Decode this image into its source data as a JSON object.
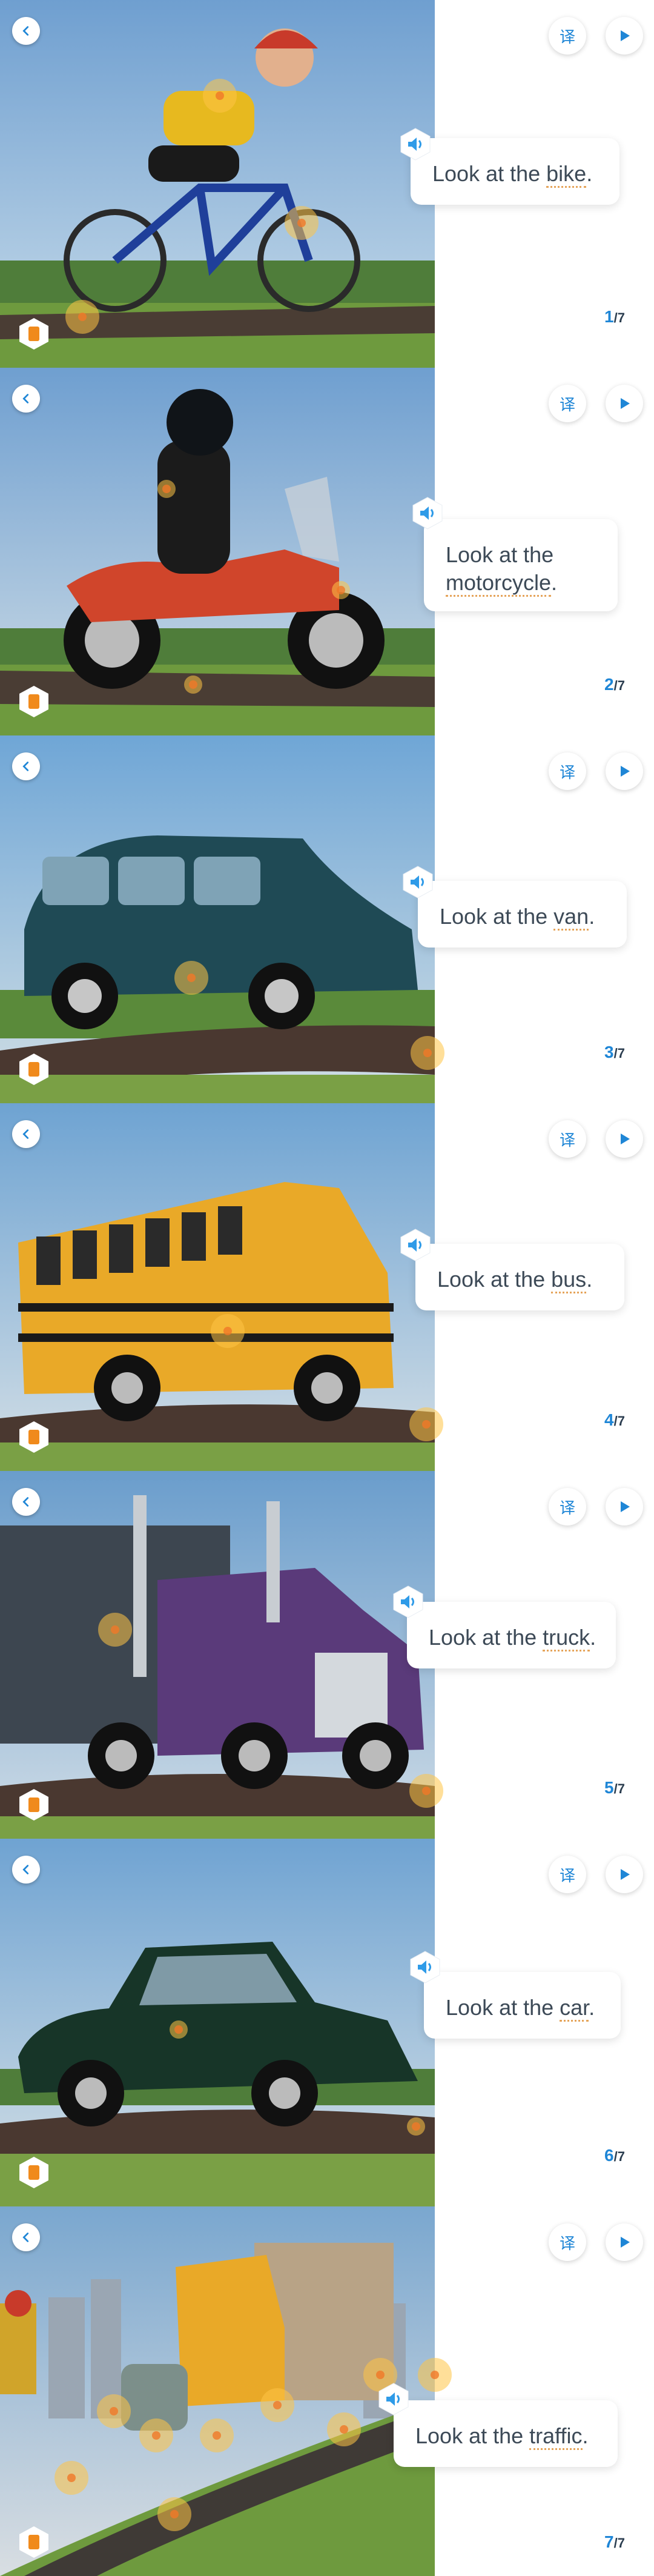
{
  "controls": {
    "back_icon": "chevron-left-icon",
    "translate_label": "译",
    "play_icon": "play-icon",
    "book_icon": "book-icon",
    "speaker_icon": "speaker-icon"
  },
  "colors": {
    "accent": "#1f86d6",
    "keyword_underline": "#e5a45a",
    "text": "#3d4a57"
  },
  "pages": [
    {
      "text_before": "Look at the ",
      "keyword": "bike",
      "text_after": ".",
      "current": "1",
      "separator": "/",
      "total": "7"
    },
    {
      "text_before": "Look at the ",
      "keyword": "motorcycle",
      "text_after": ".",
      "current": "2",
      "separator": "/",
      "total": "7"
    },
    {
      "text_before": "Look at the ",
      "keyword": "van",
      "text_after": ".",
      "current": "3",
      "separator": "/",
      "total": "7"
    },
    {
      "text_before": "Look at the ",
      "keyword": "bus",
      "text_after": ".",
      "current": "4",
      "separator": "/",
      "total": "7"
    },
    {
      "text_before": "Look at the ",
      "keyword": "truck",
      "text_after": ".",
      "current": "5",
      "separator": "/",
      "total": "7"
    },
    {
      "text_before": "Look at the ",
      "keyword": "car",
      "text_after": ".",
      "current": "6",
      "separator": "/",
      "total": "7"
    },
    {
      "text_before": "Look at the ",
      "keyword": "traffic",
      "text_after": ".",
      "current": "7",
      "separator": "/",
      "total": "7"
    }
  ]
}
